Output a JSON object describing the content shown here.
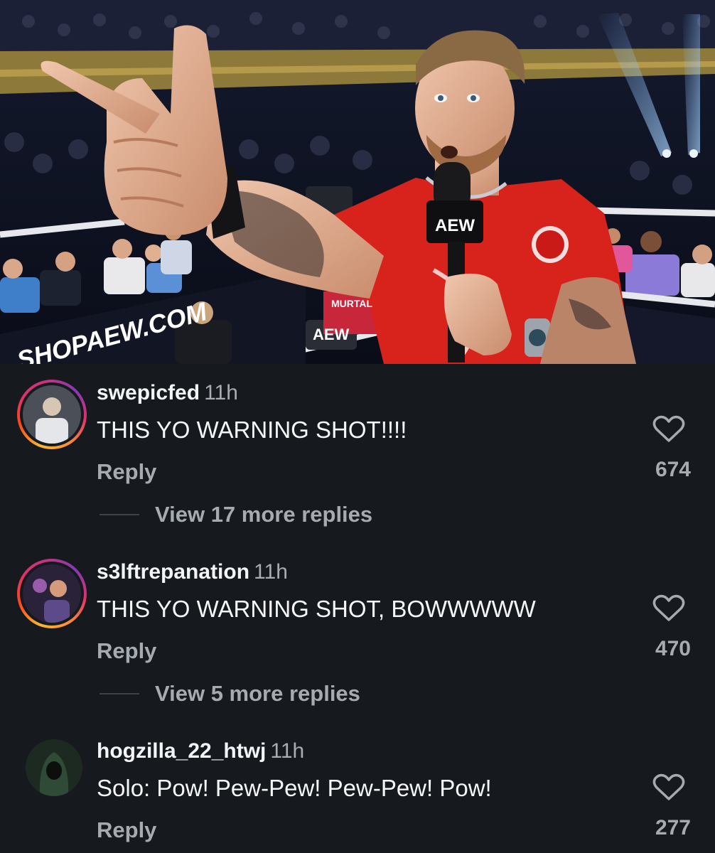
{
  "photo": {
    "mic_logo": "AEW",
    "banner_left": "SHOPAEW.COM",
    "ring_logo": "AEW",
    "sign_text": "MURTAL"
  },
  "comments": [
    {
      "username": "swepicfed",
      "time": "11h",
      "text": "THIS YO WARNING SHOT!!!!",
      "reply_label": "Reply",
      "likes": "674",
      "view_replies": "View 17 more replies",
      "story_ring": true
    },
    {
      "username": "s3lftrepanation",
      "time": "11h",
      "text": "THIS YO WARNING SHOT, BOWWWWW",
      "reply_label": "Reply",
      "likes": "470",
      "view_replies": "View 5 more replies",
      "story_ring": true
    },
    {
      "username": "hogzilla_22_htwj",
      "time": "11h",
      "text": "Solo: Pow! Pew-Pew! Pew-Pew! Pow!",
      "reply_label": "Reply",
      "likes": "277",
      "story_ring": false
    }
  ],
  "icons": {
    "like": "heart-outline-icon"
  },
  "colors": {
    "background": "#16191d",
    "muted": "#a6abb1",
    "shirt": "#d8231d"
  }
}
